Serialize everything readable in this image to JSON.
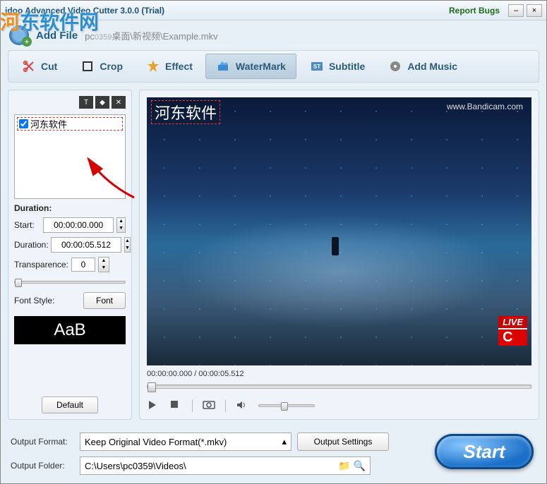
{
  "titlebar": {
    "title": "idoo Advanced Video Cutter 3.0.0 (Trial)",
    "report": "Report Bugs"
  },
  "logo_overlay": "河东软件网",
  "addfile": {
    "label": "Add File",
    "path_prefix": "pc",
    "path_sub": "0359",
    "path_rest": "桌面\\新视频\\Example.mkv"
  },
  "tabs": {
    "cut": "Cut",
    "crop": "Crop",
    "effect": "Effect",
    "watermark": "WaterMark",
    "subtitle": "Subtitle",
    "addmusic": "Add Music"
  },
  "watermark_panel": {
    "item_text": "河东软件",
    "duration_label": "Duration:",
    "start_label": "Start:",
    "start_value": "00:00:00.000",
    "dur_label": "Duration:",
    "dur_value": "00:00:05.512",
    "transparence_label": "Transparence:",
    "transparence_value": "0",
    "fontstyle_label": "Font Style:",
    "font_btn": "Font",
    "font_preview": "AaB",
    "default_btn": "Default"
  },
  "preview": {
    "overlay_text": "河东软件",
    "bandicam": "www.Bandicam.com",
    "live": "LIVE",
    "live_sub": "C",
    "time_readout": "00:00:00.000 / 00:00:05.512"
  },
  "output": {
    "format_label": "Output Format:",
    "format_value": "Keep Original Video Format(*.mkv)",
    "settings_btn": "Output Settings",
    "folder_label": "Output Folder:",
    "folder_value": "C:\\Users\\pc0359\\Videos\\",
    "start_btn": "Start"
  }
}
